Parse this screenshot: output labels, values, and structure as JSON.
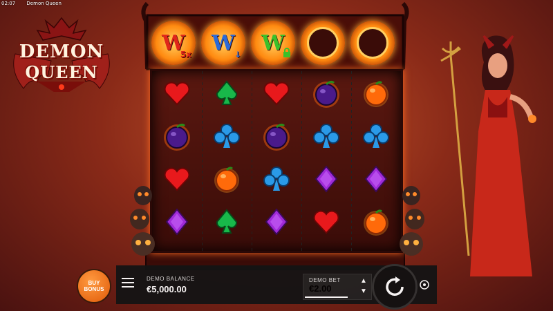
{
  "top_bar": {
    "time": "02:07",
    "app_title": "Demon Queen"
  },
  "logo": {
    "line1": "DEMON",
    "line2": "QUEEN"
  },
  "wild_row": [
    {
      "type": "wild",
      "letter": "W",
      "color": "#e0261a",
      "tag": "5x",
      "tag_color": "#e0261a"
    },
    {
      "type": "wild",
      "letter": "W",
      "color": "#2a6ad8",
      "tag": "↓",
      "tag_color": "#2a6ad8"
    },
    {
      "type": "wild",
      "letter": "W",
      "color": "#3ac02a",
      "tag": "lock",
      "tag_color": "#3ac02a"
    },
    {
      "type": "empty-ring"
    },
    {
      "type": "empty-ring"
    }
  ],
  "reels": [
    [
      "heart",
      "plum",
      "heart",
      "diamond"
    ],
    [
      "spade",
      "club",
      "orange",
      "spade"
    ],
    [
      "heart",
      "plum",
      "club",
      "diamond"
    ],
    [
      "plum",
      "club",
      "diamond",
      "heart"
    ],
    [
      "orange",
      "club",
      "diamond",
      "orange"
    ]
  ],
  "symbol_colors": {
    "heart": "#e8191c",
    "spade": "#18b84a",
    "club": "#2a9ae8",
    "diamond": "#a02ad8",
    "orange": "#ff6a0a",
    "plum": "#4a1a8a"
  },
  "controls": {
    "buy_bonus_label": "BUY BONUS",
    "balance_label": "DEMO BALANCE",
    "balance_value": "€5,000.00",
    "bet_label": "DEMO BET",
    "bet_value": "€2.00"
  }
}
